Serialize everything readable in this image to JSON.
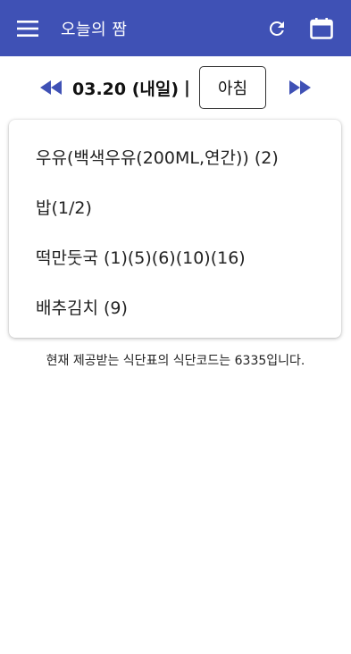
{
  "app_bar": {
    "title": "오늘의 짬",
    "background_color": "#3f51b5",
    "icons": {
      "menu": "hamburger-menu-icon",
      "refresh": "refresh-icon",
      "calendar": "calendar-icon"
    }
  },
  "date_nav": {
    "date_label": "03.20 (내일)",
    "separator": "|",
    "meal_selector": "아침",
    "arrow_color": "#3f51b5",
    "icons": {
      "prev": "double-arrow-left-icon",
      "next": "double-arrow-right-icon"
    }
  },
  "menu_card": {
    "items": [
      "우유(백색우유(200ML,연간)) (2)",
      "밥(1/2)",
      "떡만둣국 (1)(5)(6)(10)(16)",
      "배추김치 (9)"
    ]
  },
  "footer": {
    "note": "현재 제공받는 식단표의 식단코드는 6335입니다."
  }
}
